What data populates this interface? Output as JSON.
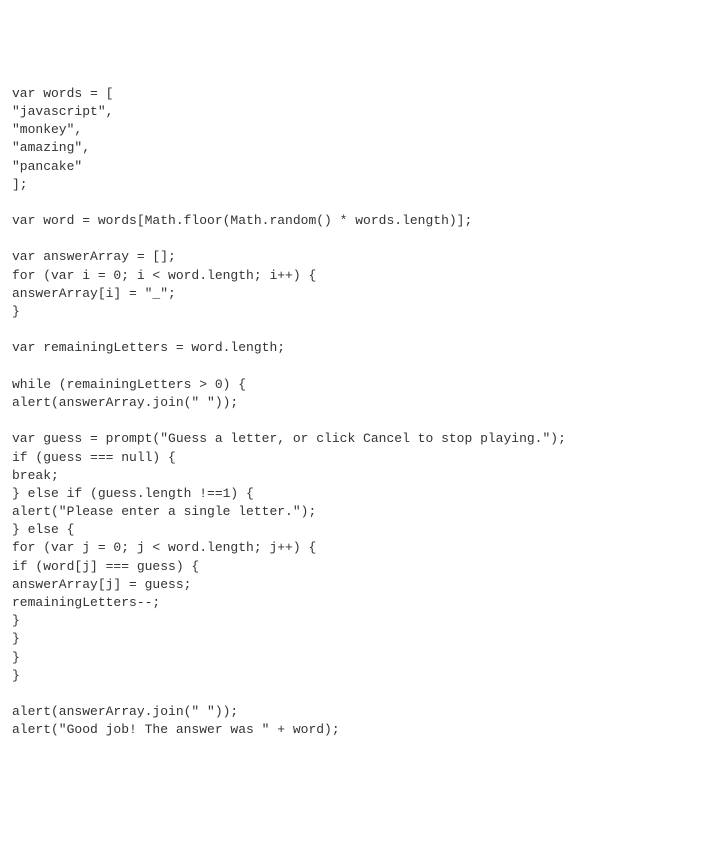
{
  "code": {
    "lines": [
      "var words = [",
      "\"javascript\",",
      "\"monkey\",",
      "\"amazing\",",
      "\"pancake\"",
      "];",
      "",
      "var word = words[Math.floor(Math.random() * words.length)];",
      "",
      "var answerArray = [];",
      "for (var i = 0; i < word.length; i++) {",
      "answerArray[i] = \"_\";",
      "}",
      "",
      "var remainingLetters = word.length;",
      "",
      "while (remainingLetters > 0) {",
      "alert(answerArray.join(\" \"));",
      "",
      "var guess = prompt(\"Guess a letter, or click Cancel to stop playing.\");",
      "if (guess === null) {",
      "break;",
      "} else if (guess.length !==1) {",
      "alert(\"Please enter a single letter.\");",
      "} else {",
      "for (var j = 0; j < word.length; j++) {",
      "if (word[j] === guess) {",
      "answerArray[j] = guess;",
      "remainingLetters--;",
      "}",
      "}",
      "}",
      "}",
      "",
      "alert(answerArray.join(\" \"));",
      "alert(\"Good job! The answer was \" + word);"
    ]
  }
}
